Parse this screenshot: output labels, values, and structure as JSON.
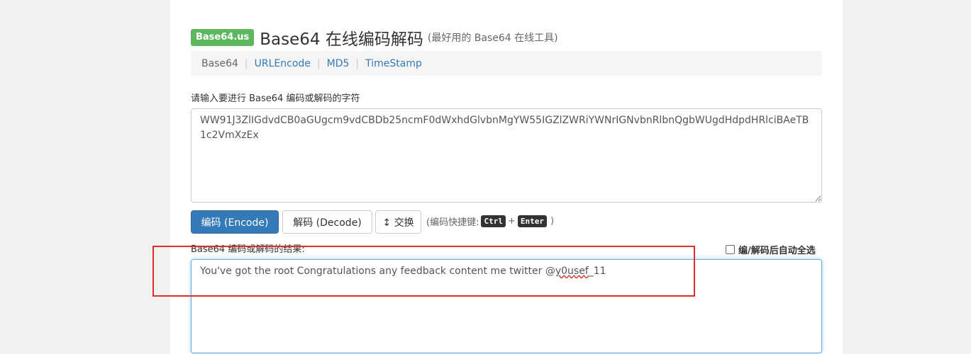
{
  "header": {
    "badge": "Base64.us",
    "title": "Base64 在线编码解码",
    "subtitle": "(最好用的 Base64 在线工具)"
  },
  "nav": {
    "items": [
      {
        "label": "Base64"
      },
      {
        "label": "URLEncode"
      },
      {
        "label": "MD5"
      },
      {
        "label": "TimeStamp"
      }
    ],
    "separator": "|"
  },
  "input": {
    "label": "请输入要进行 Base64 编码或解码的字符",
    "value": "WW91J3ZlIGdvdCB0aGUgcm9vdCBDb25ncmF0dWxhdGlvbnMgYW55IGZlZWRiYWNrIGNvbnRlbnQgbWUgdHdpdHRlciBAeTB1c2VmXzEx"
  },
  "buttons": {
    "encode": "编码 (Encode)",
    "decode": "解码 (Decode)",
    "swap": "↕ 交换"
  },
  "shortcut": {
    "prefix": "(编码快捷键:",
    "key1": "Ctrl",
    "plus": "+",
    "key2": "Enter",
    "suffix": ")"
  },
  "output": {
    "label": "Base64 编码或解码的结果:",
    "auto_select_label": "编/解码后自动全选",
    "value_main": "You've got the root Congratulations any feedback content me twitter @",
    "value_flagged": "y0usef",
    "value_end": "_11"
  },
  "colors": {
    "badge": "#5cb85c",
    "primary": "#337ab7",
    "highlight_box": "#d9302c"
  }
}
